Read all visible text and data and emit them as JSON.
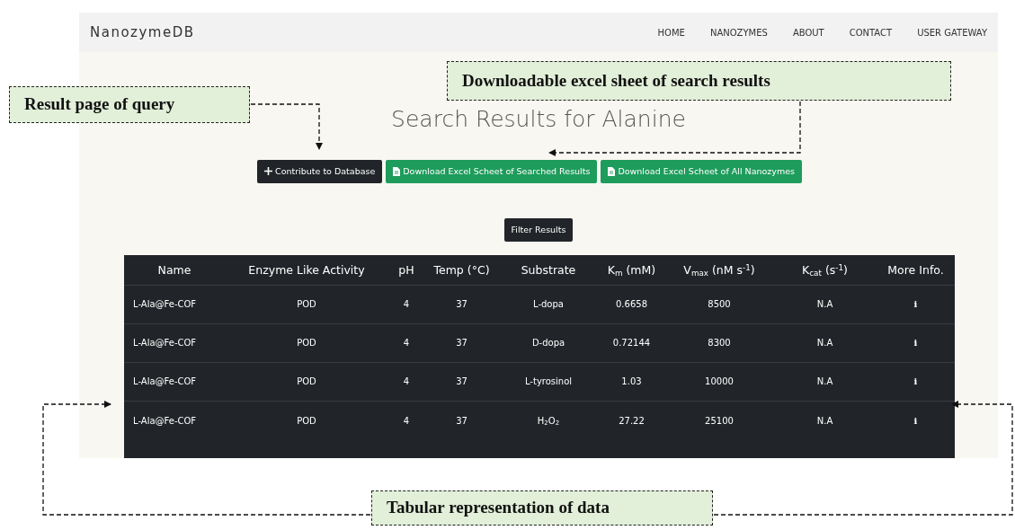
{
  "navbar": {
    "brand": "NanozymeDB",
    "links": [
      {
        "label": "HOME"
      },
      {
        "label": "NANOZYMES"
      },
      {
        "label": "ABOUT"
      },
      {
        "label": "CONTACT"
      },
      {
        "label": "USER GATEWAY"
      }
    ]
  },
  "title": "Search Results for Alanine",
  "buttons": [
    {
      "kind": "contribute",
      "label": "Contribute to Database"
    },
    {
      "kind": "download",
      "label": "Download Excel Scheet of Searched Results"
    },
    {
      "kind": "download",
      "label": "Download Excel Scheet of All Nanozymes"
    }
  ],
  "filter_button": "Filter Results",
  "table": {
    "columns": [
      "Name",
      "Enzyme Like Activity",
      "pH",
      "Temp (°C)",
      "Substrate",
      "K$_{m}$  (mM)",
      "V$_{max}$  (nM s$^{-1}$)",
      "K$_{cat}$  (s$^{-1}$)",
      "More Info."
    ],
    "rows": [
      [
        "L-Ala@Fe-COF",
        "POD",
        "4",
        "37",
        "L-dopa",
        "0.6658",
        "8500",
        "N.A",
        "i"
      ],
      [
        "L-Ala@Fe-COF",
        "POD",
        "4",
        "37",
        "D-dopa",
        "0.72144",
        "8300",
        "N.A",
        "i"
      ],
      [
        "L-Ala@Fe-COF",
        "POD",
        "4",
        "37",
        "L-tyrosinol",
        "1.03",
        "10000",
        "N.A",
        "i"
      ],
      [
        "L-Ala@Fe-COF",
        "POD",
        "4",
        "37",
        "H$_{2}$O$_{2}$",
        "27.22",
        "25100",
        "N.A",
        "i"
      ]
    ]
  },
  "annotations": [
    {
      "label": "Result page of query"
    },
    {
      "label": "Downloadable excel sheet of search results"
    },
    {
      "label": "Tabular representation of data"
    }
  ]
}
